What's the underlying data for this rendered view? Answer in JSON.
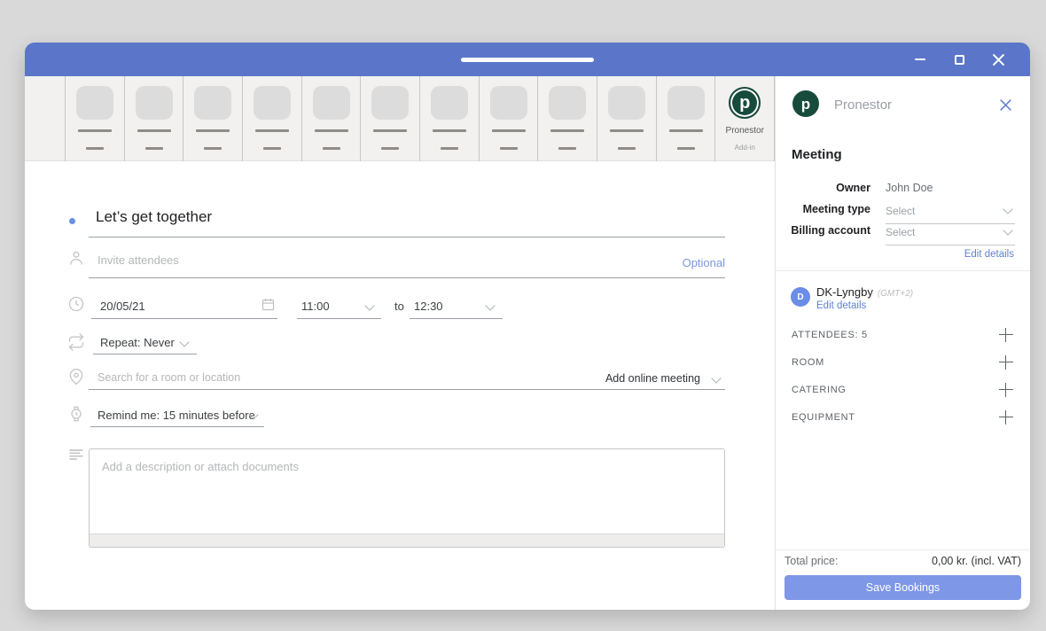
{
  "ribbon": {
    "addin": {
      "logo_letter": "p",
      "label": "Pronestor",
      "sublabel": "Add-in"
    }
  },
  "form": {
    "title": {
      "value": "Let’s get together"
    },
    "attendees": {
      "placeholder": "Invite attendees",
      "optional_label": "Optional"
    },
    "datetime": {
      "date": "20/05/21",
      "start_time": "11:00",
      "to_label": "to",
      "end_time": "12:30"
    },
    "repeat": {
      "value": "Repeat: Never"
    },
    "location": {
      "placeholder": "Search for a room or location",
      "online_meeting_label": "Add online meeting"
    },
    "reminder": {
      "value": "Remind me: 15 minutes before"
    },
    "description": {
      "placeholder": "Add a description or attach documents"
    }
  },
  "panel": {
    "app_name": "Pronestor",
    "logo_letter": "p",
    "section_title": "Meeting",
    "owner_label": "Owner",
    "owner_value": "John Doe",
    "meeting_type_label": "Meeting type",
    "meeting_type_value": "Select",
    "billing_label": "Billing account",
    "billing_value": "Select",
    "edit_details_link": "Edit details",
    "location": {
      "avatar_letter": "D",
      "name": "DK-Lyngby",
      "timezone": "(GMT+2)",
      "edit_link": "Edit details"
    },
    "categories": [
      "ATTENDEES: 5",
      "ROOM",
      "CATERING",
      "EQUIPMENT"
    ],
    "footer": {
      "total_label": "Total price:",
      "total_value": "0,00 kr. (incl. VAT)",
      "save_button": "Save Bookings"
    }
  },
  "colors": {
    "titlebar_blue": "#5b76c9",
    "accent_blue": "#6180cf",
    "save_button_blue": "#7e97e6",
    "brand_green": "#174b3c",
    "avatar_blue": "#6b8de8"
  }
}
